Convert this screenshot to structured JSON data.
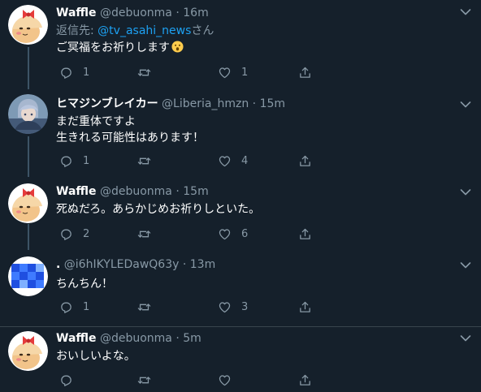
{
  "tweets": [
    {
      "name": "Waffle",
      "handle": "@debuonma",
      "dot": "·",
      "time": "16m",
      "reply_label": "返信先: ",
      "reply_mention": "@tv_asahi_news",
      "reply_suffix": "さん",
      "text": "ご冥福をお祈りします",
      "emoji": "astonished-face-emoji",
      "reply_count": "1",
      "retweet_count": "",
      "like_count": "1",
      "avatar": "waffle-avatar"
    },
    {
      "name": "ヒマジンブレイカー",
      "handle": "@Liberia_hmzn",
      "dot": "·",
      "time": "15m",
      "text_line1": "まだ重体ですよ",
      "text_line2": "生きれる可能性はあります！",
      "reply_count": "1",
      "retweet_count": "",
      "like_count": "4",
      "avatar": "anime-character-avatar"
    },
    {
      "name": "Waffle",
      "handle": "@debuonma",
      "dot": "·",
      "time": "15m",
      "text": "死ぬだろ。あらかじめお祈りしといた。",
      "reply_count": "2",
      "retweet_count": "",
      "like_count": "6",
      "avatar": "waffle-avatar"
    },
    {
      "name": ".",
      "handle": "@i6hIKYLEDawQ63y",
      "dot": "·",
      "time": "13m",
      "text": "ちんちん！",
      "reply_count": "1",
      "retweet_count": "",
      "like_count": "3",
      "avatar": "blue-pixel-avatar"
    },
    {
      "name": "Waffle",
      "handle": "@debuonma",
      "dot": "·",
      "time": "5m",
      "text": "おいしいよな。",
      "reply_count": "",
      "retweet_count": "",
      "like_count": "",
      "avatar": "waffle-avatar"
    }
  ],
  "colors": {
    "background": "#15202b",
    "secondary_text": "#8899a6",
    "link": "#1da1f2",
    "divider": "#38444d"
  },
  "icons": [
    "reply-icon",
    "retweet-icon",
    "like-icon",
    "share-icon",
    "chevron-down-icon"
  ]
}
